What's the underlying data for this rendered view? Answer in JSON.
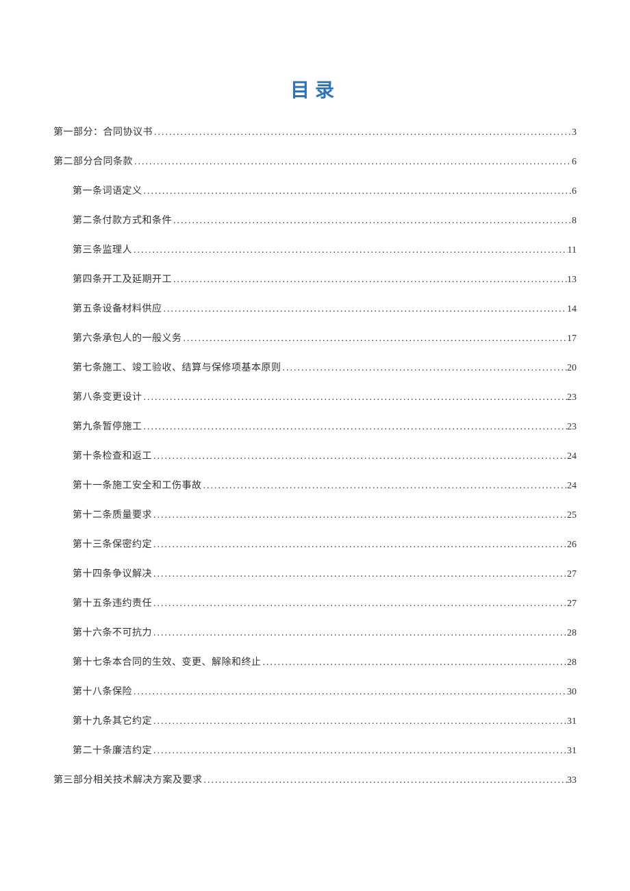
{
  "title": "目录",
  "entries": [
    {
      "level": 1,
      "label": "第一部分：合同协议书",
      "page": "3"
    },
    {
      "level": 1,
      "label": "第二部分合同条款",
      "page": "6"
    },
    {
      "level": 2,
      "label": "第一条词语定义",
      "page": "6"
    },
    {
      "level": 2,
      "label": "第二条付款方式和条件",
      "page": "8"
    },
    {
      "level": 2,
      "label": "第三条监理人",
      "page": "11"
    },
    {
      "level": 2,
      "label": "第四条开工及延期开工",
      "page": "13"
    },
    {
      "level": 2,
      "label": "第五条设备材料供应",
      "page": "14"
    },
    {
      "level": 2,
      "label": "第六条承包人的一般义务",
      "page": "17"
    },
    {
      "level": 2,
      "label": "第七条施工、竣工验收、结算与保修项基本原则",
      "page": "20"
    },
    {
      "level": 2,
      "label": "第八条变更设计",
      "page": "23"
    },
    {
      "level": 2,
      "label": "第九条暂停施工",
      "page": "23"
    },
    {
      "level": 2,
      "label": "第十条检查和返工",
      "page": "24"
    },
    {
      "level": 2,
      "label": "第十一条施工安全和工伤事故",
      "page": "24"
    },
    {
      "level": 2,
      "label": "第十二条质量要求",
      "page": "25"
    },
    {
      "level": 2,
      "label": "第十三条保密约定",
      "page": "26"
    },
    {
      "level": 2,
      "label": "第十四条争议解决",
      "page": "27"
    },
    {
      "level": 2,
      "label": "第十五条违约责任",
      "page": "27"
    },
    {
      "level": 2,
      "label": "第十六条不可抗力",
      "page": "28"
    },
    {
      "level": 2,
      "label": "第十七条本合同的生效、变更、解除和终止",
      "page": "28"
    },
    {
      "level": 2,
      "label": "第十八条保险",
      "page": "30"
    },
    {
      "level": 2,
      "label": "第十九条其它约定",
      "page": "31"
    },
    {
      "level": 2,
      "label": "第二十条廉洁约定",
      "page": "31"
    },
    {
      "level": 1,
      "label": "第三部分相关技术解决方案及要求",
      "page": "33"
    }
  ]
}
